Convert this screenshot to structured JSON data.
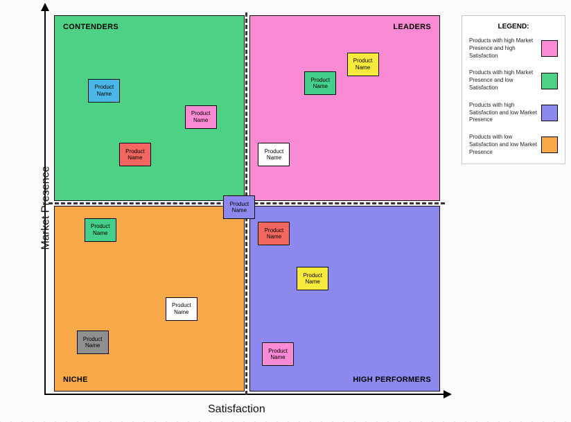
{
  "axes": {
    "x": "Satisfaction",
    "y": "Market Presence"
  },
  "quadrants": {
    "tl": "CONTENDERS",
    "tr": "LEADERS",
    "bl": "NICHE",
    "br": "HIGH PERFORMERS"
  },
  "legend": {
    "title": "LEGEND:",
    "items": [
      {
        "text": "Products with high Market Presence and high Satisfaction",
        "color": "#fa8ad4"
      },
      {
        "text": "Products with high Market Presence and low Satisfaction",
        "color": "#4dd184"
      },
      {
        "text": "Products with high Satisfaction and low Market Presence",
        "color": "#8d88ee"
      },
      {
        "text": "Products with low Satisfaction and low Market Presence",
        "color": "#f7a94a"
      }
    ]
  },
  "productLabel": "Product Name",
  "chart_data": {
    "type": "scatter",
    "xlabel": "Satisfaction",
    "ylabel": "Market Presence",
    "xlim": [
      0,
      100
    ],
    "ylim": [
      0,
      100
    ],
    "points": [
      {
        "name": "Product Name",
        "x": 13,
        "y": 80,
        "color": "#4cb7e6",
        "quadrant": "Contenders"
      },
      {
        "name": "Product Name",
        "x": 38,
        "y": 73,
        "color": "#fa8ad4",
        "quadrant": "Contenders"
      },
      {
        "name": "Product Name",
        "x": 21,
        "y": 63,
        "color": "#f4675f",
        "quadrant": "Contenders"
      },
      {
        "name": "Product Name",
        "x": 69,
        "y": 82,
        "color": "#44cf8c",
        "quadrant": "Leaders"
      },
      {
        "name": "Product Name",
        "x": 80,
        "y": 87,
        "color": "#f8ea3c",
        "quadrant": "Leaders"
      },
      {
        "name": "Product Name",
        "x": 57,
        "y": 63,
        "color": "#ffffff",
        "quadrant": "Leaders"
      },
      {
        "name": "Product Name",
        "x": 48,
        "y": 49,
        "color": "#8d88ee",
        "quadrant": "boundary"
      },
      {
        "name": "Product Name",
        "x": 12,
        "y": 43,
        "color": "#44cf8c",
        "quadrant": "Niche"
      },
      {
        "name": "Product Name",
        "x": 33,
        "y": 22,
        "color": "#ffffff",
        "quadrant": "Niche"
      },
      {
        "name": "Product Name",
        "x": 10,
        "y": 13,
        "color": "#8f8f8f",
        "quadrant": "Niche"
      },
      {
        "name": "Product Name",
        "x": 57,
        "y": 42,
        "color": "#f4675f",
        "quadrant": "High Performers"
      },
      {
        "name": "Product Name",
        "x": 67,
        "y": 30,
        "color": "#f8ea3c",
        "quadrant": "High Performers"
      },
      {
        "name": "Product Name",
        "x": 58,
        "y": 10,
        "color": "#fa8ad4",
        "quadrant": "High Performers"
      }
    ]
  }
}
